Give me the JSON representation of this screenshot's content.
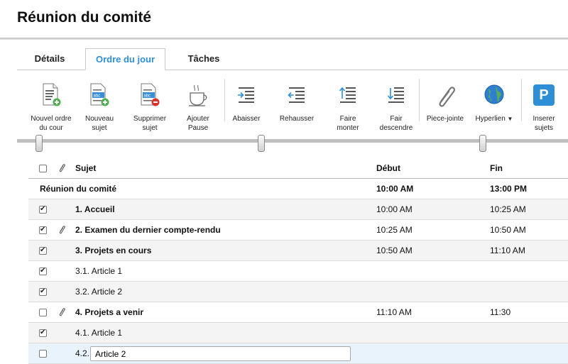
{
  "app": {
    "title": "Réunion du comité"
  },
  "tabs": [
    {
      "label": "Détails"
    },
    {
      "label": "Ordre du jour"
    },
    {
      "label": "Tâches"
    }
  ],
  "toolbar": {
    "new_agenda_label": "Nouvel ordre du cour",
    "new_subject_label": "Nouveau sujet",
    "delete_subject_label": "Supprimer sujet",
    "add_pause_label": "Ajouter Pause",
    "lower_label": "Abaisser",
    "raise_label": "Rehausser",
    "move_up_label": "Faire monter",
    "move_down_label": "Fair descendre",
    "attachment_label": "Piece-jointe",
    "hyperlink_label": "Hyperlien",
    "insert_subjects_label": "Inserer sujets",
    "insert_icon_glyph": "P",
    "accent_color": "#2f8fd6"
  },
  "grid": {
    "headers": {
      "subject": "Sujet",
      "start": "Début",
      "end": "Fin"
    },
    "meeting": {
      "subject": "Réunion du comité",
      "start": "10:00 AM",
      "end": "13:00 PM"
    },
    "rows": [
      {
        "subject": "1. Accueil",
        "start": "10:00 AM",
        "end": "10:25 AM",
        "checked": true,
        "clip": false,
        "bold": true
      },
      {
        "subject": "2. Examen du dernier compte-rendu",
        "start": "10:25 AM",
        "end": "10:50 AM",
        "checked": true,
        "clip": true,
        "bold": true
      },
      {
        "subject": "3. Projets en cours",
        "start": "10:50 AM",
        "end": "11:10 AM",
        "checked": true,
        "clip": false,
        "bold": true
      },
      {
        "subject": "3.1. Article 1",
        "start": "",
        "end": "",
        "checked": true,
        "clip": false,
        "bold": false
      },
      {
        "subject": "3.2. Article 2",
        "start": "",
        "end": "",
        "checked": true,
        "clip": false,
        "bold": false
      },
      {
        "subject": "4. Projets a venir",
        "start": "11:10 AM",
        "end": "11:30",
        "checked": false,
        "clip": true,
        "bold": true
      },
      {
        "subject": "4.1. Article 1",
        "start": "",
        "end": "",
        "checked": true,
        "clip": false,
        "bold": false
      }
    ],
    "edit_row": {
      "prefix": "4.2.",
      "value": "Article 2"
    }
  }
}
